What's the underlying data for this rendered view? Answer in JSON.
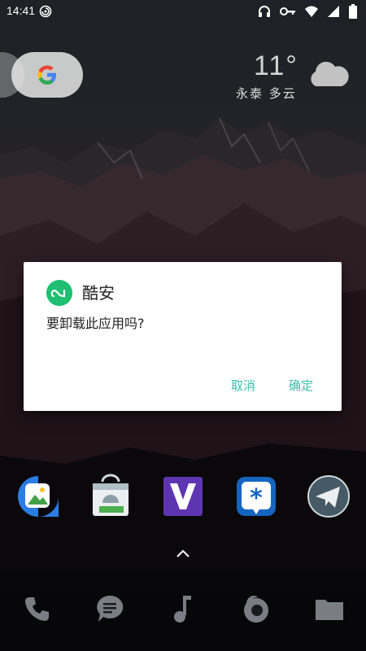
{
  "status_bar": {
    "time": "14:41",
    "icons": [
      "notification-swirl-icon",
      "headphones-icon",
      "key-icon",
      "wifi-icon",
      "cellular-signal-icon",
      "battery-icon"
    ]
  },
  "home": {
    "search_widget": {
      "logo_letter": "G",
      "icon": "google-logo-icon"
    },
    "weather": {
      "temperature": "11°",
      "location_condition": "永泰  多云",
      "icon": "cloud-icon"
    },
    "app_row": [
      {
        "name": "gallery-app-icon"
      },
      {
        "name": "android-store-app-icon"
      },
      {
        "name": "v-app-icon"
      },
      {
        "name": "asterisk-app-icon"
      },
      {
        "name": "telegram-app-icon"
      }
    ],
    "app_drawer_hint_icon": "chevron-up-icon",
    "dock": [
      {
        "name": "phone-icon"
      },
      {
        "name": "messages-icon"
      },
      {
        "name": "music-icon"
      },
      {
        "name": "firefox-icon"
      },
      {
        "name": "folder-icon"
      }
    ]
  },
  "dialog": {
    "app_icon": "coolapk-icon",
    "app_name": "酷安",
    "message": "要卸载此应用吗?",
    "cancel_label": "取消",
    "ok_label": "确定",
    "accent_color": "#3bbfad",
    "app_icon_color": "#1fbf71"
  }
}
